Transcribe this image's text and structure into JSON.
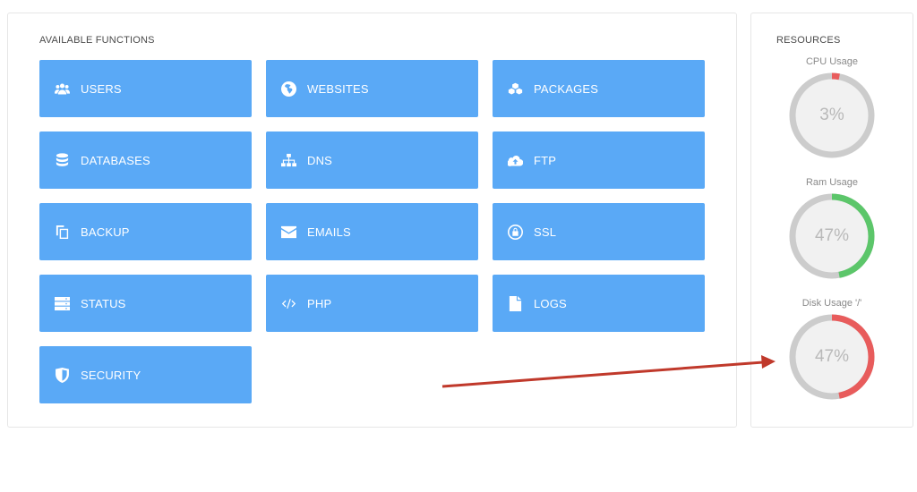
{
  "functions": {
    "title": "AVAILABLE FUNCTIONS",
    "tiles": [
      {
        "label": "USERS",
        "icon": "users-icon"
      },
      {
        "label": "WEBSITES",
        "icon": "globe-icon"
      },
      {
        "label": "PACKAGES",
        "icon": "cubes-icon"
      },
      {
        "label": "DATABASES",
        "icon": "database-icon"
      },
      {
        "label": "DNS",
        "icon": "sitemap-icon"
      },
      {
        "label": "FTP",
        "icon": "cloud-upload-icon"
      },
      {
        "label": "BACKUP",
        "icon": "copy-icon"
      },
      {
        "label": "EMAILS",
        "icon": "envelope-icon"
      },
      {
        "label": "SSL",
        "icon": "lock-icon"
      },
      {
        "label": "STATUS",
        "icon": "server-icon"
      },
      {
        "label": "PHP",
        "icon": "code-icon"
      },
      {
        "label": "LOGS",
        "icon": "file-icon"
      },
      {
        "label": "SECURITY",
        "icon": "shield-icon"
      }
    ]
  },
  "resources": {
    "title": "RESOURCES",
    "gauges": [
      {
        "label": "CPU Usage",
        "value": "3%",
        "fraction": 0.03,
        "color": "#e85c5c"
      },
      {
        "label": "Ram Usage",
        "value": "47%",
        "fraction": 0.47,
        "color": "#5cc66a"
      },
      {
        "label": "Disk Usage '/'",
        "value": "47%",
        "fraction": 0.47,
        "color": "#e85c5c"
      }
    ]
  },
  "colors": {
    "tile": "#5aa9f6",
    "gauge_track": "#cccccc",
    "gauge_fill_bg": "#f1f1f1",
    "annotation_arrow": "#c0392b"
  }
}
